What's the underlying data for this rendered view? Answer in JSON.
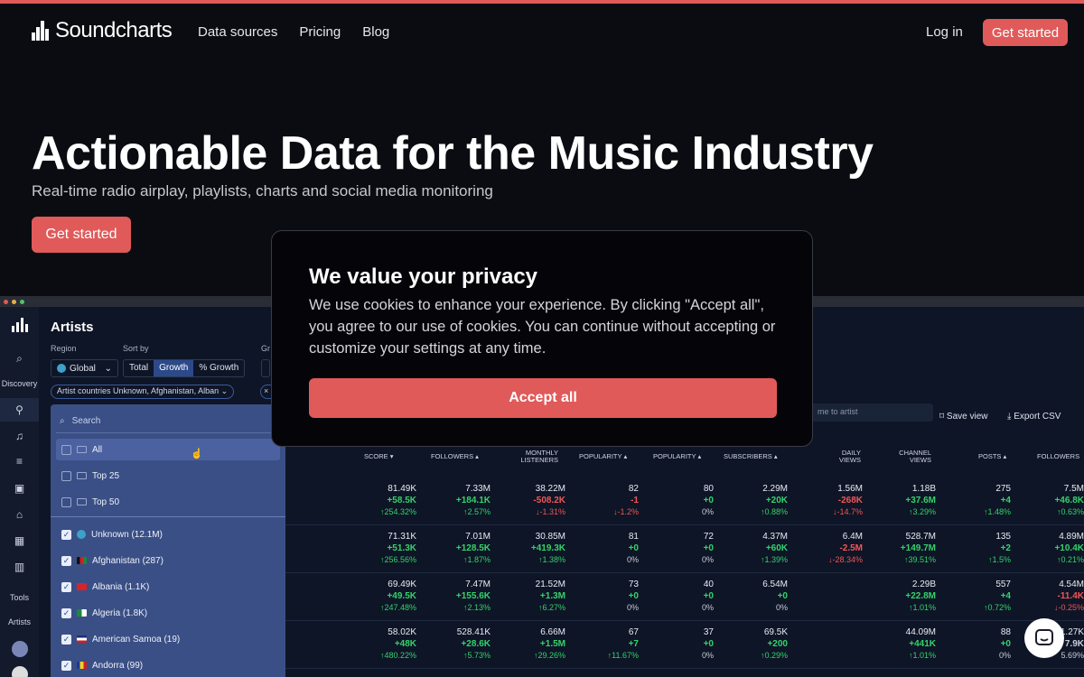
{
  "header": {
    "logo_text": "Soundcharts",
    "links": [
      "Data sources",
      "Pricing",
      "Blog"
    ],
    "login": "Log in",
    "cta": "Get started"
  },
  "hero": {
    "title": "Actionable Data for the Music Industry",
    "subtitle": "Real-time radio airplay, playlists, charts and social media monitoring",
    "cta": "Get started"
  },
  "modal": {
    "title": "We value your privacy",
    "body": "We use cookies to enhance your experience. By clicking \"Accept all\", you agree to our use of cookies. You can continue without accepting or customize your settings at any time.",
    "accept": "Accept all"
  },
  "app": {
    "sidebar": {
      "discovery": "Discovery",
      "tools": "Tools",
      "artists": "Artists"
    },
    "title": "Artists",
    "region_label": "Region",
    "region_value": "Global",
    "sort_label": "Sort by",
    "sort_options": [
      "Total",
      "Growth",
      "% Growth"
    ],
    "group_label": "Gr",
    "chip": "Artist countries  Unknown, Afghanistan, Alban",
    "search_placeholder": "Search",
    "top_options": [
      "All",
      "Top 25",
      "Top 50"
    ],
    "countries": [
      "Unknown (12.1M)",
      "Afghanistan (287)",
      "Albania (1.1K)",
      "Algeria (1.8K)",
      "American Samoa (19)",
      "Andorra (99)"
    ],
    "to_artist": "me to artist",
    "save_view": "Save view",
    "export_csv": "Export CSV",
    "columns": [
      "SCORE",
      "FOLLOWERS",
      "MONTHLY LISTENERS",
      "POPULARITY",
      "POPULARITY",
      "SUBSCRIBERS",
      "DAILY VIEWS",
      "CHANNEL VIEWS",
      "POSTS",
      "FOLLOWERS"
    ],
    "rows": [
      [
        [
          "81.49K",
          "+58.5K",
          "↑254.32%"
        ],
        [
          "7.33M",
          "+184.1K",
          "↑2.57%"
        ],
        [
          "38.22M",
          "-508.2K",
          "↓-1.31%"
        ],
        [
          "82",
          "-1",
          "↓-1.2%"
        ],
        [
          "80",
          "+0",
          "0%"
        ],
        [
          "2.29M",
          "+20K",
          "↑0.88%"
        ],
        [
          "1.56M",
          "-268K",
          "↓-14.7%"
        ],
        [
          "1.18B",
          "+37.6M",
          "↑3.29%"
        ],
        [
          "275",
          "+4",
          "↑1.48%"
        ],
        [
          "7.5M",
          "+46.8K",
          "↑0.63%"
        ]
      ],
      [
        [
          "71.31K",
          "+51.3K",
          "↑256.56%"
        ],
        [
          "7.01M",
          "+128.5K",
          "↑1.87%"
        ],
        [
          "30.85M",
          "+419.3K",
          "↑1.38%"
        ],
        [
          "81",
          "+0",
          "0%"
        ],
        [
          "72",
          "+0",
          "0%"
        ],
        [
          "4.37M",
          "+60K",
          "↑1.39%"
        ],
        [
          "6.4M",
          "-2.5M",
          "↓-28.34%"
        ],
        [
          "528.7M",
          "+149.7M",
          "↑39.51%"
        ],
        [
          "135",
          "+2",
          "↑1.5%"
        ],
        [
          "4.89M",
          "+10.4K",
          "↑0.21%"
        ]
      ],
      [
        [
          "69.49K",
          "+49.5K",
          "↑247.48%"
        ],
        [
          "7.47M",
          "+155.6K",
          "↑2.13%"
        ],
        [
          "21.52M",
          "+1.3M",
          "↑6.27%"
        ],
        [
          "73",
          "+0",
          "0%"
        ],
        [
          "40",
          "+0",
          "0%"
        ],
        [
          "6.54M",
          "+0",
          "0%"
        ],
        [
          "",
          "",
          ""
        ],
        [
          "2.29B",
          "+22.8M",
          "↑1.01%"
        ],
        [
          "557",
          "+4",
          "↑0.72%"
        ],
        [
          "4.54M",
          "-11.4K",
          "↓-0.25%"
        ]
      ],
      [
        [
          "58.02K",
          "+48K",
          "↑480.22%"
        ],
        [
          "528.41K",
          "+28.6K",
          "↑5.73%"
        ],
        [
          "6.66M",
          "+1.5M",
          "↑29.26%"
        ],
        [
          "67",
          "+7",
          "↑11.67%"
        ],
        [
          "37",
          "+0",
          "0%"
        ],
        [
          "69.5K",
          "+200",
          "↑0.29%"
        ],
        [
          "",
          "",
          ""
        ],
        [
          "44.09M",
          "+441K",
          "↑1.01%"
        ],
        [
          "88",
          "+0",
          "0%"
        ],
        [
          "1.27K",
          "7.9K",
          "5.69%"
        ]
      ]
    ]
  }
}
